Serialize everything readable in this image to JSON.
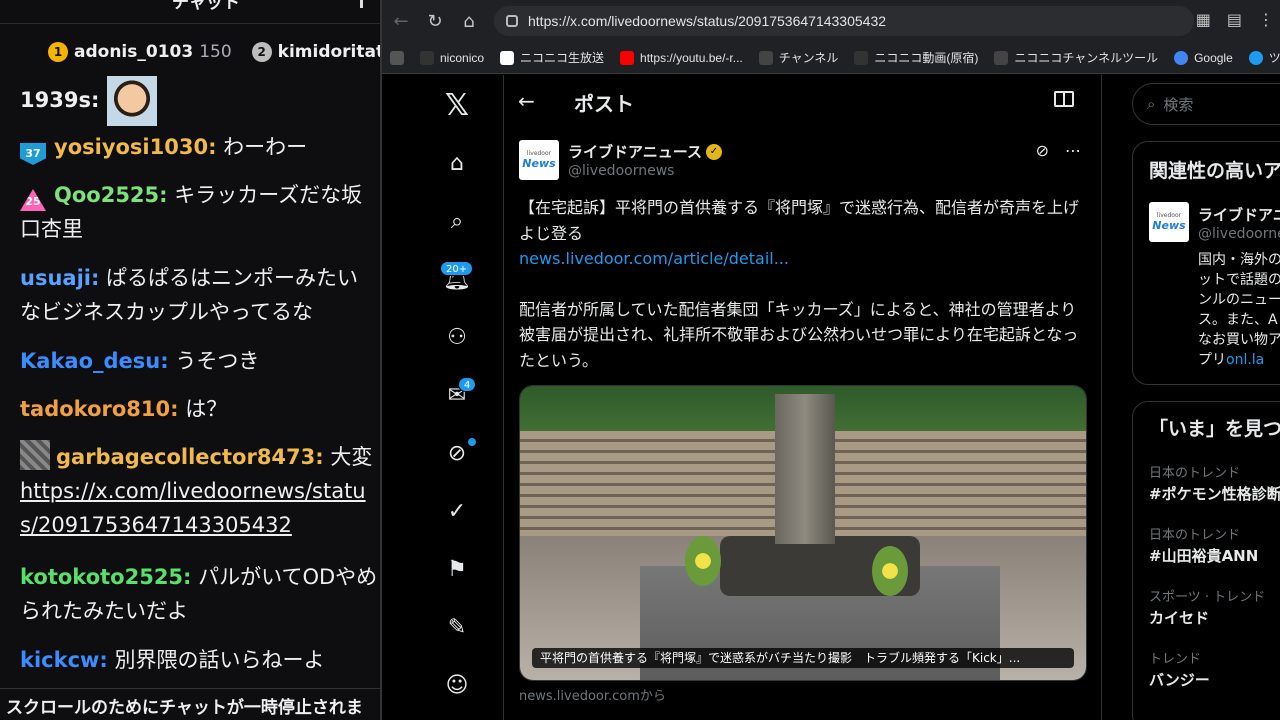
{
  "chat": {
    "header_partial": "チャット",
    "leaderboard": [
      {
        "rank": "1",
        "name": "adonis_0103",
        "score": "150",
        "color": "#f4b400"
      },
      {
        "rank": "2",
        "name": "kimidoritatey",
        "score": "",
        "color": "#bdbdbd"
      }
    ],
    "messages": [
      {
        "user": "1939s:",
        "body": "",
        "user_color": "#efeff1"
      },
      {
        "badge": "37",
        "user": "yosiyosi1030:",
        "body": " わーわー",
        "user_color": "#f1b94a"
      },
      {
        "badge": "25",
        "user": "Qoo2525:",
        "body": " キラッカーズだな坂口杏里",
        "user_color": "#7de07d"
      },
      {
        "user": "usuaji:",
        "body": " ぱるぱるはニンポーみたいなビジネスカップルやってるな",
        "user_color": "#5aa0ff"
      },
      {
        "user": "Kakao_desu:",
        "body": " うそつき",
        "user_color": "#3b8cff"
      },
      {
        "user": "tadokoro810:",
        "body": " は？",
        "user_color": "#f0a040"
      },
      {
        "user": "garbagecollector8473:",
        "body": " 大変",
        "link": "https://x.com/livedoornews/status/2091753647143305432",
        "user_color": "#f1b94a"
      },
      {
        "user": "kotokoto2525:",
        "body": " パルがいてODやめられたみたいだよ",
        "user_color": "#58e06a"
      },
      {
        "user": "kickcw:",
        "body": " 別界隈の話いらねーよ",
        "user_color": "#3b8cff"
      }
    ],
    "paused_notice": "スクロールのためにチャットが一時停止されま"
  },
  "browser": {
    "url": "https://x.com/livedoornews/status/2091753647143305432",
    "bookmarks": [
      {
        "label": "",
        "icon": "folder-icon",
        "color": "#333"
      },
      {
        "label": "niconico",
        "icon": "folder-icon",
        "color": "#333"
      },
      {
        "label": "ニコニコ生放送",
        "icon": "nicolive-icon",
        "color": "#fff"
      },
      {
        "label": "https://youtu.be/-r...",
        "icon": "youtube-icon",
        "color": "#ff0000"
      },
      {
        "label": "チャンネル",
        "icon": "niconico-icon",
        "color": "#444"
      },
      {
        "label": "ニコニコ動画(原宿)",
        "icon": "folder-icon",
        "color": "#333"
      },
      {
        "label": "ニコニコチャンネルツール",
        "icon": "niconico-icon",
        "color": "#444"
      },
      {
        "label": "Google",
        "icon": "google-icon",
        "color": "#4285f4"
      },
      {
        "label": "ツイ",
        "icon": "twitter-icon",
        "color": "#1d9bf0"
      }
    ]
  },
  "x": {
    "nav_badges": {
      "notifications": "20+",
      "messages": "4"
    },
    "header_title": "ポスト",
    "author": {
      "name": "ライブドアニュース",
      "handle": "@livedoornews",
      "logo_top": "livedoor",
      "logo_main": "News"
    },
    "post": {
      "line1": "【在宅起訴】平将門の首供養する『将門塚』で迷惑行為、配信者が奇声を上げよじ登る",
      "link": "news.livedoor.com/article/detail...",
      "line2": "配信者が所属していた配信者集団「キッカーズ」によると、神社の管理者より被害届が提出され、礼拝所不敬罪および公然わいせつ罪により在宅起訴となったという。",
      "media_caption": "平将門の首供養する『将門塚』で迷惑系がバチ当たり撮影　トラブル頻発する「Kick」...",
      "source": "news.livedoor.comから"
    },
    "sidebar": {
      "search_placeholder": "検索",
      "related_title": "関連性の高いア",
      "related_name": "ライブドアニ",
      "related_handle": "@livedoorne",
      "related_bio": "国内・海外のットで話題のンルのニュース。また、Aなお買い物アプリ",
      "related_bio_link": "onl.la",
      "trends_title": "「いま」を見つ",
      "trends": [
        {
          "context": "日本のトレンド",
          "title": "#ポケモン性格診断"
        },
        {
          "context": "日本のトレンド",
          "title": "#山田裕貴ANN"
        },
        {
          "context": "スポーツ · トレンド",
          "title": "カイセド"
        },
        {
          "context": "トレンド",
          "title": "バンジー"
        }
      ]
    }
  }
}
